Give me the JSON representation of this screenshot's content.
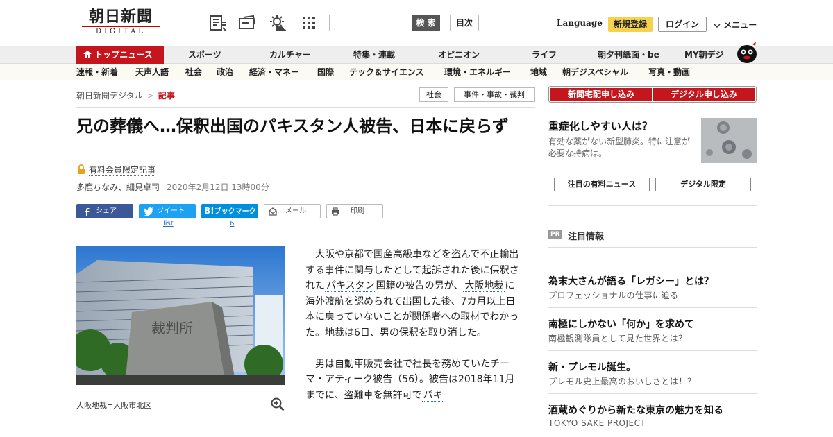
{
  "header": {
    "logo_main": "朝日新聞",
    "logo_sub": "DIGITAL",
    "search_button": "検 索",
    "toc_button": "目次",
    "language": "Language",
    "signup": "新規登録",
    "login": "ログイン",
    "menu": "メニュー",
    "icons": [
      "newspaper-icon",
      "ticket-icon",
      "weather-icon",
      "grid-icon"
    ]
  },
  "nav_primary": [
    "トップニュース",
    "スポーツ",
    "カルチャー",
    "特集・連載",
    "オピニオン",
    "ライフ",
    "朝夕刊紙面・be",
    "MY朝デジ"
  ],
  "nav_secondary": [
    "速報・新着",
    "天声人語",
    "社会",
    "政治",
    "経済・マネー",
    "国際",
    "テック＆サイエンス",
    "環境・エネルギー",
    "地域",
    "朝デジスペシャル",
    "写真・動画"
  ],
  "breadcrumb": {
    "root": "朝日新聞デジタル",
    "sep": ">",
    "current": "記事"
  },
  "tags": [
    "社会",
    "事件・事故・裁判"
  ],
  "article": {
    "title": "兄の葬儀へ…保釈出国のパキスタン人被告、日本に戻らず",
    "members_only": "有料会員限定記事",
    "authors": "多鹿ちなみ、細見卓司",
    "date": "2020年2月12日 13時00分",
    "share": {
      "facebook": "シェア",
      "twitter": "ツイート",
      "hatena": "ブックマーク",
      "hatena_mark": "B!",
      "mail": "メール",
      "print": "印刷",
      "twitter_count": "list",
      "hatena_count": "6"
    },
    "photo_caption": "大阪地裁=大阪市北区",
    "photo_plaque": "裁判所",
    "p1": {
      "a": "大阪や京都で国産高級車などを盗んで不正輸出する事件に関与したとして起訴された後に保釈された",
      "k1": "パキスタン",
      "b": "国籍の被告の男が、",
      "k2": "大阪地裁",
      "c": "に海外渡航を認められて出国した後、7カ月以上日本に戻っていないことが関係者への取材でわかった。地裁は6日、男の保釈を取り消した。"
    },
    "p2": {
      "a": "男は自動車販売会社で社長を務めていたチーマ・アティーク被告（56）。被告は2018年11月までに、盗難車を無許可で",
      "k1": "パキ"
    }
  },
  "sidebar": {
    "subscribe_paper": "新聞宅配申し込み",
    "subscribe_digital": "デジタル申し込み",
    "feature_title": "重症化しやすい人は？",
    "feature_sub": "有効な薬がない新型肺炎。特に注意が必要な持病は。",
    "tab_news": "注目の有料ニュース",
    "tab_digital": "デジタル限定",
    "pr_badge": "PR",
    "pr_title": "注目情報",
    "ads": [
      {
        "title": "為末大さんが語る「レガシー」とは？",
        "sub": "プロフェッショナルの仕事に迫る"
      },
      {
        "title": "南極にしかない「何か」を求めて",
        "sub": "南極観測隊員として見た世界とは？"
      },
      {
        "title": "新・プレモル誕生。",
        "sub": "プレモル史上最高のおいしさとは！？"
      },
      {
        "title": "酒蔵めぐりから新たな東京の魅力を知る",
        "sub": "TOKYO SAKE PROJECT"
      }
    ]
  },
  "colors": {
    "brand_red": "#c4161c",
    "signup_yellow": "#f7d24e",
    "facebook": "#3b5998",
    "twitter": "#1da1f2",
    "hatena": "#008fde"
  }
}
